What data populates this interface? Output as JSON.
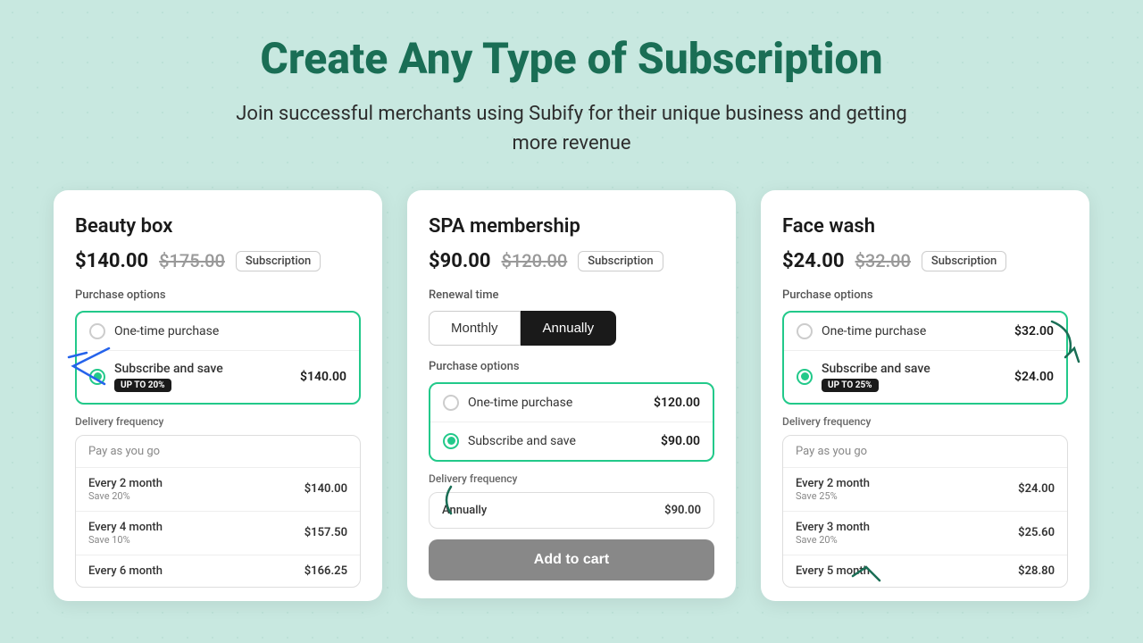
{
  "header": {
    "title": "Create Any Type of Subscription",
    "subtitle": "Join successful merchants using Subify for their unique business and getting more revenue"
  },
  "cards": [
    {
      "id": "beauty-box",
      "title": "Beauty box",
      "price_current": "$140.00",
      "price_original": "$175.00",
      "badge": "Subscription",
      "section_label": "Purchase options",
      "options": [
        {
          "label": "One-time purchase",
          "price": null,
          "selected": false
        },
        {
          "label": "Subscribe and save",
          "price": "$140.00",
          "selected": true,
          "save_badge": "UP TO 20%"
        }
      ],
      "delivery_label": "Delivery frequency",
      "freq_header": "Pay as you go",
      "freq_rows": [
        {
          "label": "Every 2 month",
          "save": "Save 20%",
          "price": "$140.00"
        },
        {
          "label": "Every 4 month",
          "save": "Save 10%",
          "price": "$157.50"
        },
        {
          "label": "Every 6 month",
          "save": "",
          "price": "$166.25"
        }
      ]
    },
    {
      "id": "spa-membership",
      "title": "SPA membership",
      "price_current": "$90.00",
      "price_original": "$120.00",
      "badge": "Subscription",
      "renewal_label": "Renewal time",
      "toggle_monthly": "Monthly",
      "toggle_annually": "Annually",
      "active_toggle": "annually",
      "purchase_label": "Purchase options",
      "options": [
        {
          "label": "One-time purchase",
          "price": "$120.00",
          "selected": false
        },
        {
          "label": "Subscribe and save",
          "price": "$90.00",
          "selected": true
        }
      ],
      "delivery_label": "Delivery frequency",
      "annually_row_label": "Annually",
      "annually_row_price": "$90.00",
      "add_to_cart": "Add to cart"
    },
    {
      "id": "face-wash",
      "title": "Face wash",
      "price_current": "$24.00",
      "price_original": "$32.00",
      "badge": "Subscription",
      "section_label": "Purchase options",
      "options": [
        {
          "label": "One-time purchase",
          "price": "$32.00",
          "selected": false
        },
        {
          "label": "Subscribe and save",
          "price": "$24.00",
          "selected": true,
          "save_badge": "UP TO 25%"
        }
      ],
      "delivery_label": "Delivery frequency",
      "freq_header": "Pay as you go",
      "freq_rows": [
        {
          "label": "Every 2 month",
          "save": "Save 25%",
          "price": "$24.00"
        },
        {
          "label": "Every 3 month",
          "save": "Save 20%",
          "price": "$25.60"
        },
        {
          "label": "Every 5 month",
          "save": "",
          "price": "$28.80"
        }
      ]
    }
  ]
}
